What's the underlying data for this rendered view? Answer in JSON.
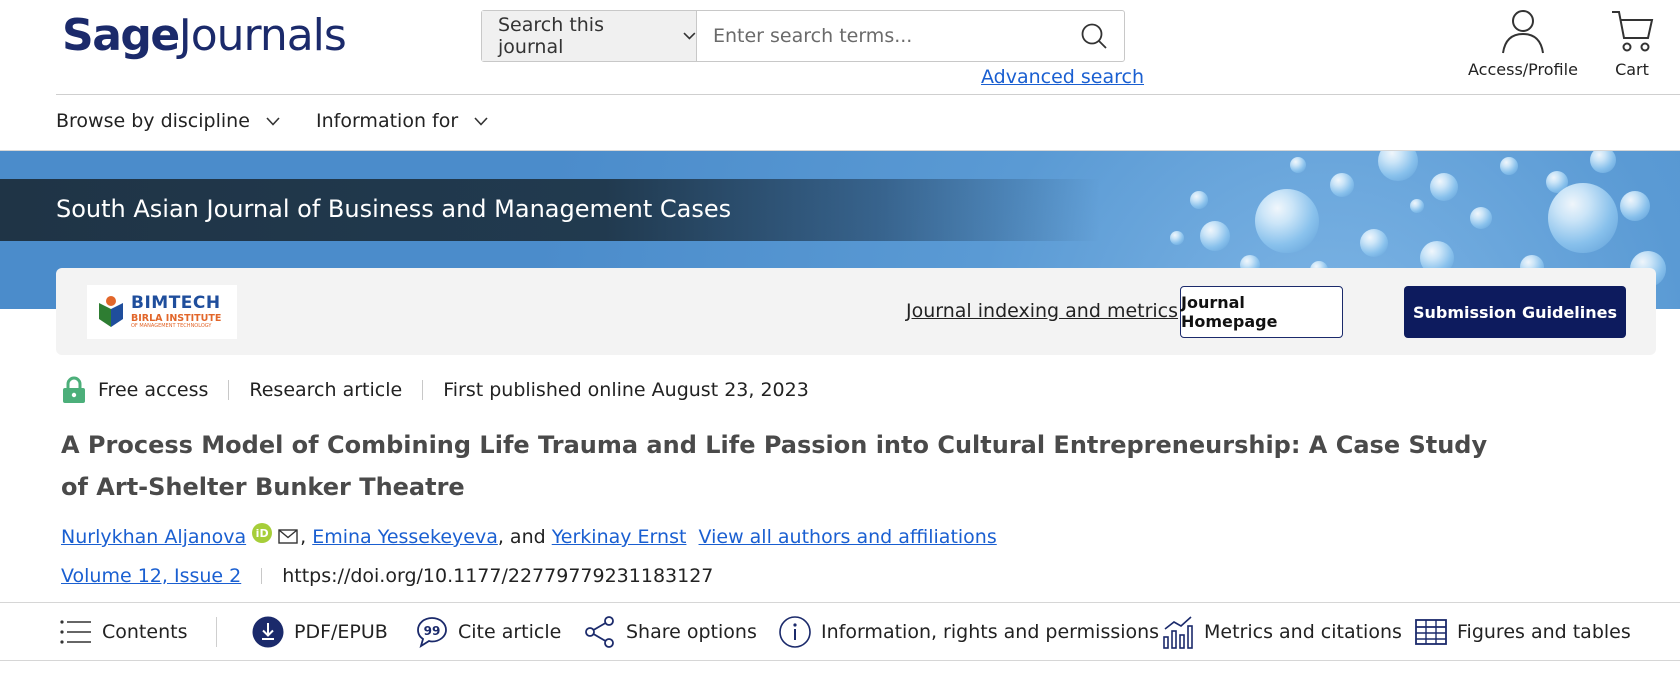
{
  "header": {
    "brand_primary": "Sage",
    "brand_secondary": "Journals",
    "search_scope": "Search this journal",
    "search_placeholder": "Enter search terms...",
    "advanced_search": "Advanced search",
    "access_label": "Access/Profile",
    "cart_label": "Cart"
  },
  "nav": {
    "browse": "Browse by discipline",
    "info_for": "Information for"
  },
  "banner": {
    "journal_name": "South Asian Journal of Business and Management Cases"
  },
  "journal_card": {
    "logo_name": "BIMTECH",
    "logo_sub": "BIRLA INSTITUTE",
    "logo_sub2": "OF MANAGEMENT TECHNOLOGY",
    "indexing_link": "Journal indexing and metrics",
    "homepage_button": "Journal Homepage",
    "submission_button": "Submission Guidelines"
  },
  "article": {
    "access": "Free access",
    "type": "Research article",
    "published": "First published online August 23, 2023",
    "title": "A Process Model of Combining Life Trauma and Life Passion into Cultural Entrepreneurship: A Case Study of Art-Shelter Bunker Theatre",
    "authors": [
      "Nurlykhan Aljanova",
      "Emina Yessekeyeva",
      "Yerkinay Ernst"
    ],
    "separator_comma": ",",
    "and_text": ", and",
    "orcid_badge": "iD",
    "view_all_authors": "View all authors and affiliations",
    "volume": "Volume 12, Issue 2",
    "doi": "https://doi.org/10.1177/22779779231183127"
  },
  "toolbar": {
    "contents": "Contents",
    "pdf": "PDF/EPUB",
    "cite": "Cite article",
    "share": "Share options",
    "info": "Information, rights and permissions",
    "metrics": "Metrics and citations",
    "figures": "Figures and tables"
  },
  "colors": {
    "brand": "#1b2a6b",
    "link": "#1a5fd1",
    "button_dark": "#0d1b5e",
    "lock_green": "#4caf7a",
    "orcid_green": "#a6ce39"
  },
  "icons": [
    "chevron-down-icon",
    "search-icon",
    "user-icon",
    "cart-icon",
    "lock-icon",
    "orcid-icon",
    "mail-icon",
    "list-icon",
    "download-icon",
    "quote-icon",
    "share-icon",
    "info-icon",
    "chart-icon",
    "table-icon"
  ]
}
